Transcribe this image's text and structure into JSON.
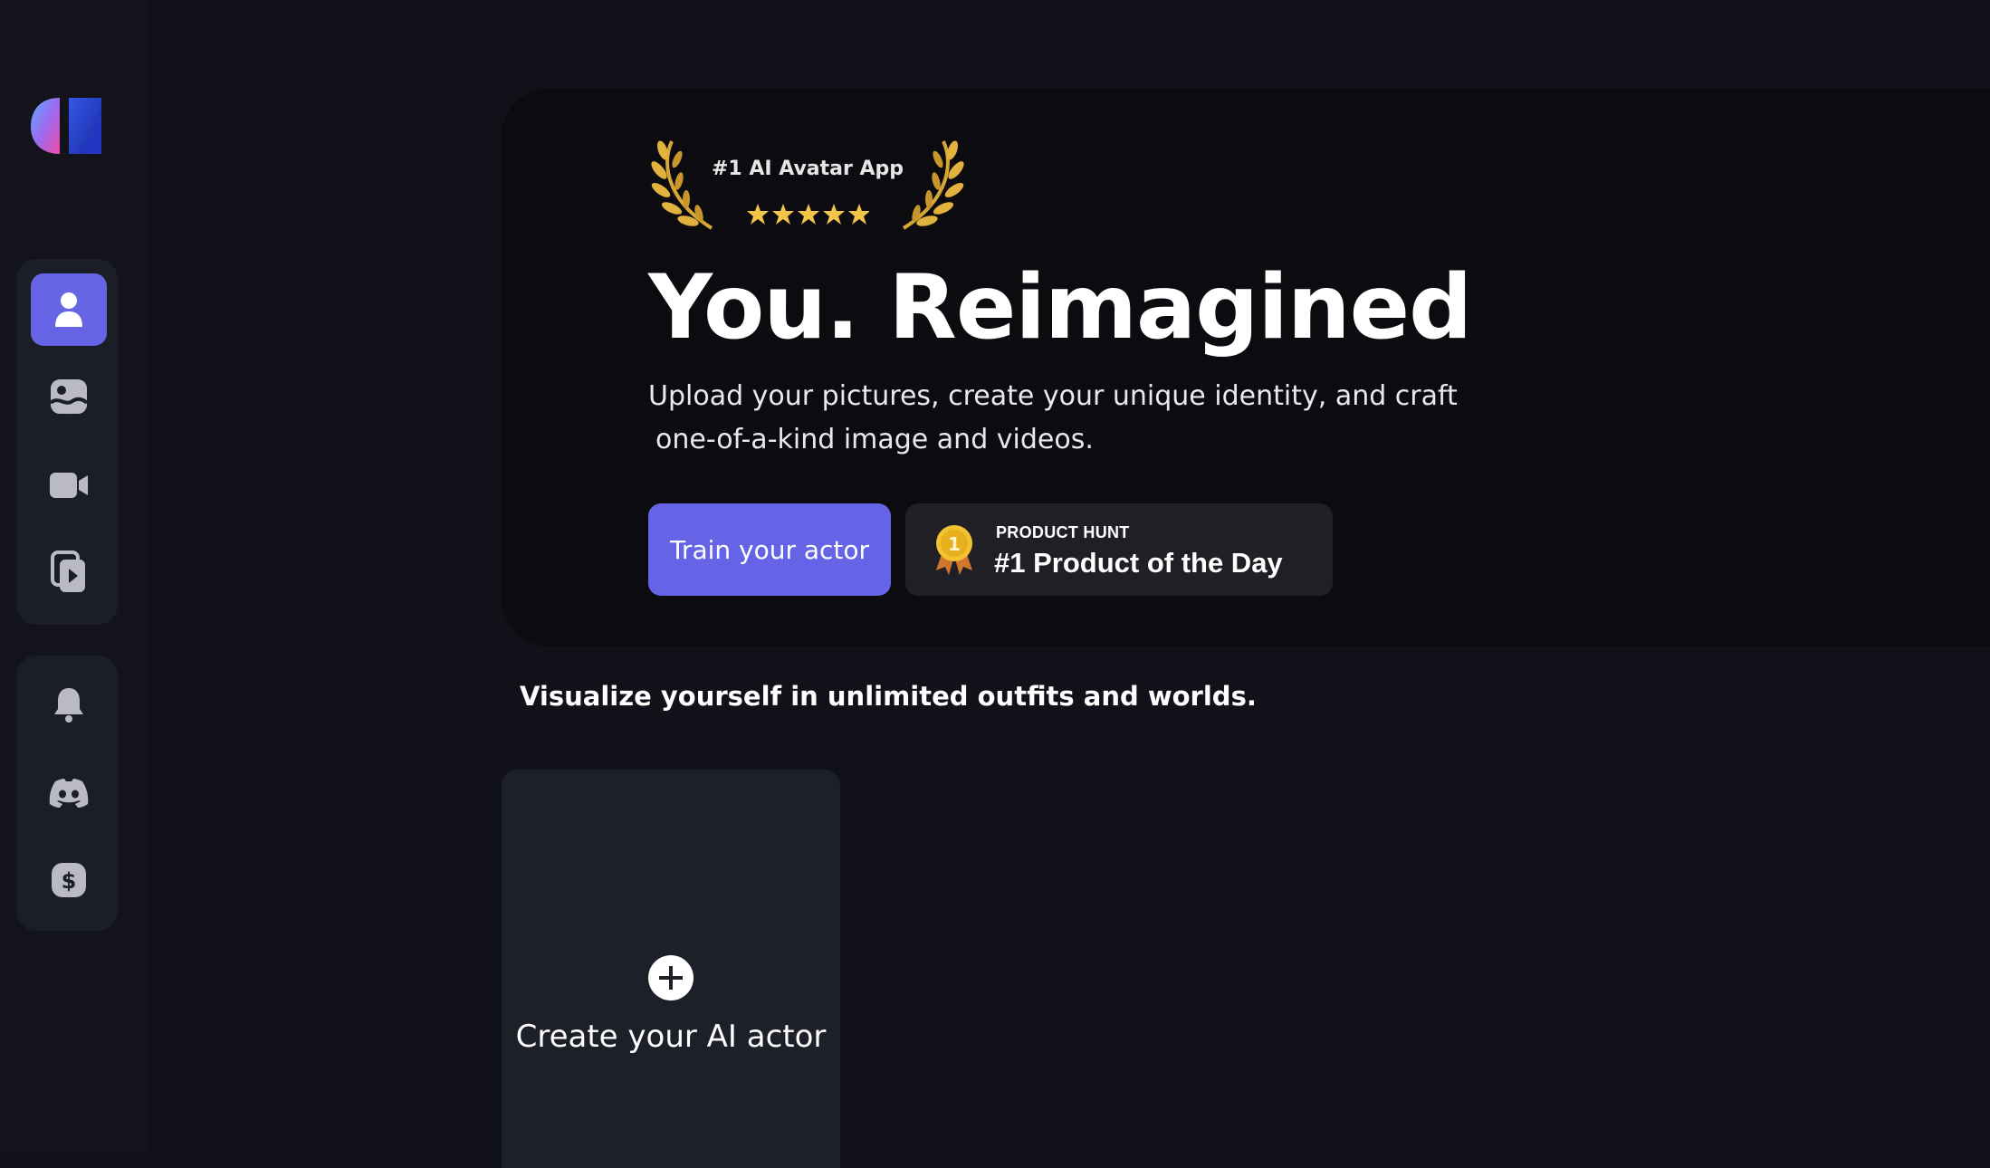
{
  "sidebar": {
    "logo": "app-logo",
    "primary_nav": [
      {
        "icon": "user-icon",
        "active": true
      },
      {
        "icon": "image-icon",
        "active": false
      },
      {
        "icon": "video-camera-icon",
        "active": false
      },
      {
        "icon": "video-gallery-icon",
        "active": false
      }
    ],
    "secondary_nav": [
      {
        "icon": "bell-icon"
      },
      {
        "icon": "discord-icon"
      },
      {
        "icon": "dollar-icon"
      }
    ],
    "accent_color": "#6464e4"
  },
  "hero": {
    "award_text": "#1 AI Avatar App",
    "award_stars": 5,
    "title": "You. Reimagined",
    "subtitle_line1": "Upload your pictures, create your unique identity, and craft",
    "subtitle_line2": "one-of-a-kind image and videos.",
    "train_button_label": "Train your actor",
    "product_hunt": {
      "label": "PRODUCT HUNT",
      "title": "#1 Product of the Day",
      "medal_number": "1"
    }
  },
  "main": {
    "tagline": "Visualize yourself in unlimited outfits and worlds.",
    "create_card_label": "Create your AI actor"
  }
}
